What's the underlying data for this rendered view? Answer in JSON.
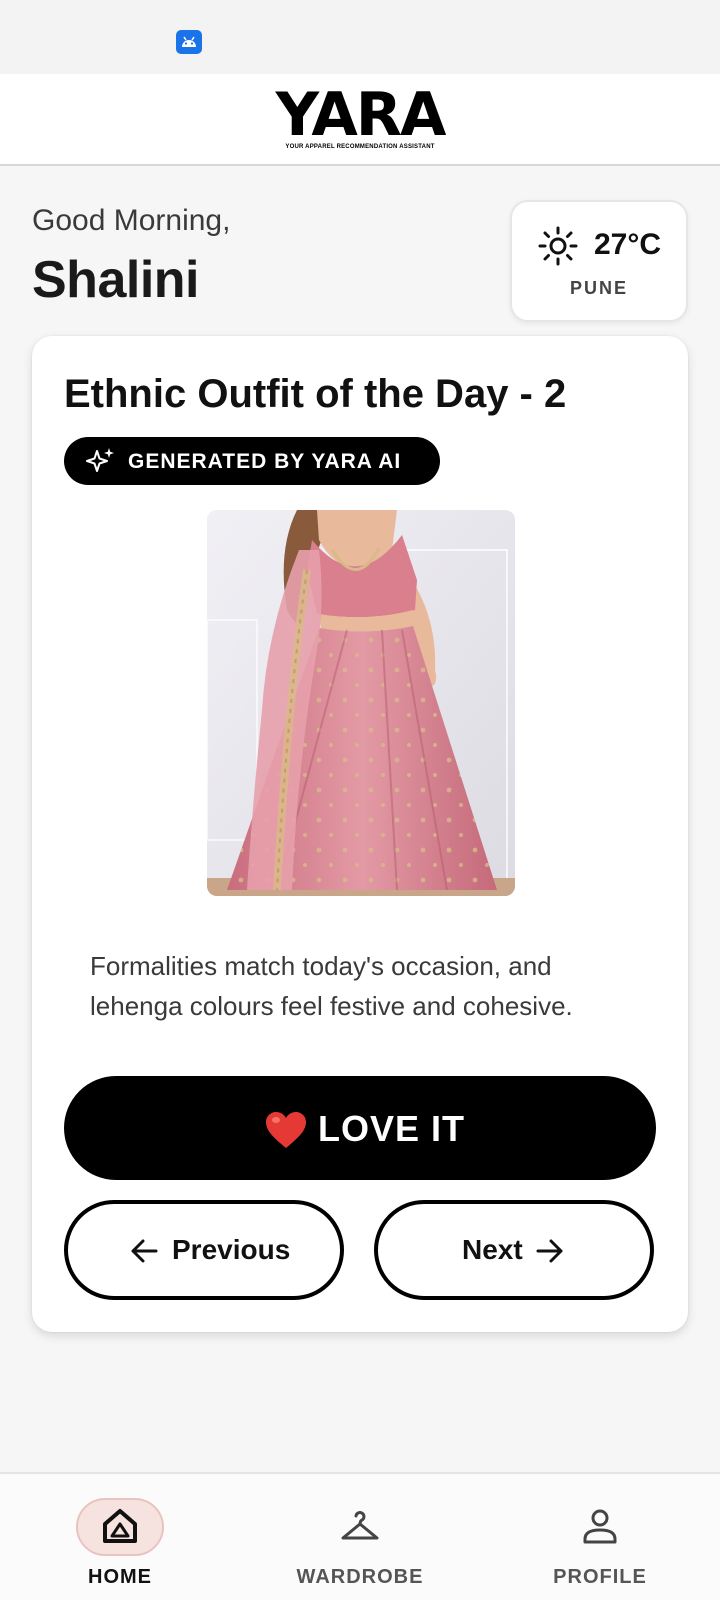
{
  "header": {
    "logo_text": "YARA",
    "logo_tagline": "YOUR APPAREL RECOMMENDATION ASSISTANT"
  },
  "greeting": {
    "salutation": "Good Morning,",
    "name": "Shalini"
  },
  "weather": {
    "icon": "sun-icon",
    "temperature": "27°C",
    "city": "PUNE"
  },
  "outfit": {
    "title": "Ethnic Outfit of the Day - 2",
    "badge_icon": "sparkle-icon",
    "badge_text": "GENERATED BY YARA AI",
    "image_alt": "Pink embroidered lehenga with dupatta",
    "description": "Formalities match today's occasion, and lehenga colours feel festive and cohesive.",
    "love_icon": "heart-icon",
    "love_label": "LOVE IT",
    "previous_label": "Previous",
    "next_label": "Next"
  },
  "bottom_nav": {
    "items": [
      {
        "label": "HOME",
        "icon": "home-icon",
        "active": true
      },
      {
        "label": "WARDROBE",
        "icon": "hanger-icon",
        "active": false
      },
      {
        "label": "PROFILE",
        "icon": "person-icon",
        "active": false
      }
    ]
  },
  "colors": {
    "accent": "#000000",
    "background": "#f6f6f6",
    "active_nav_pill": "#f6e2df",
    "love_heart": "#e53935"
  }
}
